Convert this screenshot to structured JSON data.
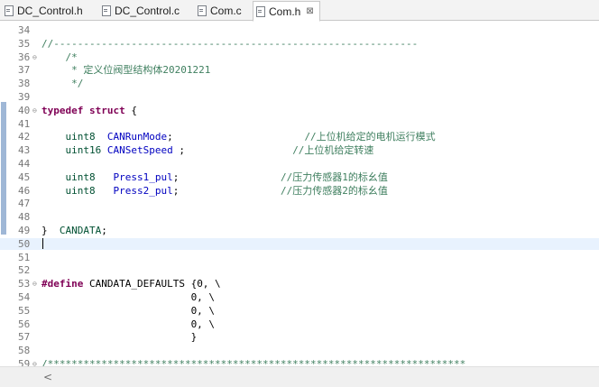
{
  "tabs": [
    {
      "label": "DC_Control.h",
      "active": false
    },
    {
      "label": "DC_Control.c",
      "active": false
    },
    {
      "label": "Com.c",
      "active": false
    },
    {
      "label": "Com.h",
      "active": true,
      "close": "⊠"
    }
  ],
  "editor": {
    "lines": [
      {
        "n": "34",
        "fold": "",
        "html": ""
      },
      {
        "n": "35",
        "fold": "",
        "html": "<span class=\"cm\">//-------------------------------------------------------------</span>"
      },
      {
        "n": "36",
        "fold": "⊖",
        "html": "    <span class=\"cm\">/*</span>"
      },
      {
        "n": "37",
        "fold": "",
        "html": "    <span class=\"cm\"> * 定义位阀型结构体20201221</span>"
      },
      {
        "n": "38",
        "fold": "",
        "html": "    <span class=\"cm\"> */</span>"
      },
      {
        "n": "39",
        "fold": "",
        "html": ""
      },
      {
        "n": "40",
        "fold": "⊖",
        "html": "<span class=\"kw\">typedef struct</span> {"
      },
      {
        "n": "41",
        "fold": "",
        "html": ""
      },
      {
        "n": "42",
        "fold": "",
        "html": "    <span class=\"ty\">uint8</span>  <span class=\"id\">CANRunMode</span>;                      <span class=\"cm\">//上位机给定的电机运行模式</span>"
      },
      {
        "n": "43",
        "fold": "",
        "html": "    <span class=\"ty\">uint16</span> <span class=\"id\">CANSetSpeed</span> ;                  <span class=\"cm\">//上位机给定转速</span>"
      },
      {
        "n": "44",
        "fold": "",
        "html": ""
      },
      {
        "n": "45",
        "fold": "",
        "html": "    <span class=\"ty\">uint8</span>   <span class=\"id\">Press1_pul</span>;                 <span class=\"cm\">//压力传感器1的标幺值</span>"
      },
      {
        "n": "46",
        "fold": "",
        "html": "    <span class=\"ty\">uint8</span>   <span class=\"id\">Press2_pul</span>;                 <span class=\"cm\">//压力传感器2的标幺值</span>"
      },
      {
        "n": "47",
        "fold": "",
        "html": ""
      },
      {
        "n": "48",
        "fold": "",
        "html": ""
      },
      {
        "n": "49",
        "fold": "",
        "html": "}  <span class=\"ty\">CANDATA</span>;"
      },
      {
        "n": "50",
        "fold": "",
        "html": "<span class=\"cursor\"></span>"
      },
      {
        "n": "51",
        "fold": "",
        "html": ""
      },
      {
        "n": "52",
        "fold": "",
        "html": ""
      },
      {
        "n": "53",
        "fold": "⊖",
        "html": "<span class=\"kw\">#define</span> CANDATA_DEFAULTS {0, \\"
      },
      {
        "n": "54",
        "fold": "",
        "html": "                         0, \\"
      },
      {
        "n": "55",
        "fold": "",
        "html": "                         0, \\"
      },
      {
        "n": "56",
        "fold": "",
        "html": "                         0, \\"
      },
      {
        "n": "57",
        "fold": "",
        "html": "                         }"
      },
      {
        "n": "58",
        "fold": "",
        "html": ""
      },
      {
        "n": "59",
        "fold": "⊖",
        "html": "<span class=\"cm\">/**********************************************************************</span>"
      }
    ]
  },
  "scrollbar": {
    "left_arrow": "<"
  }
}
